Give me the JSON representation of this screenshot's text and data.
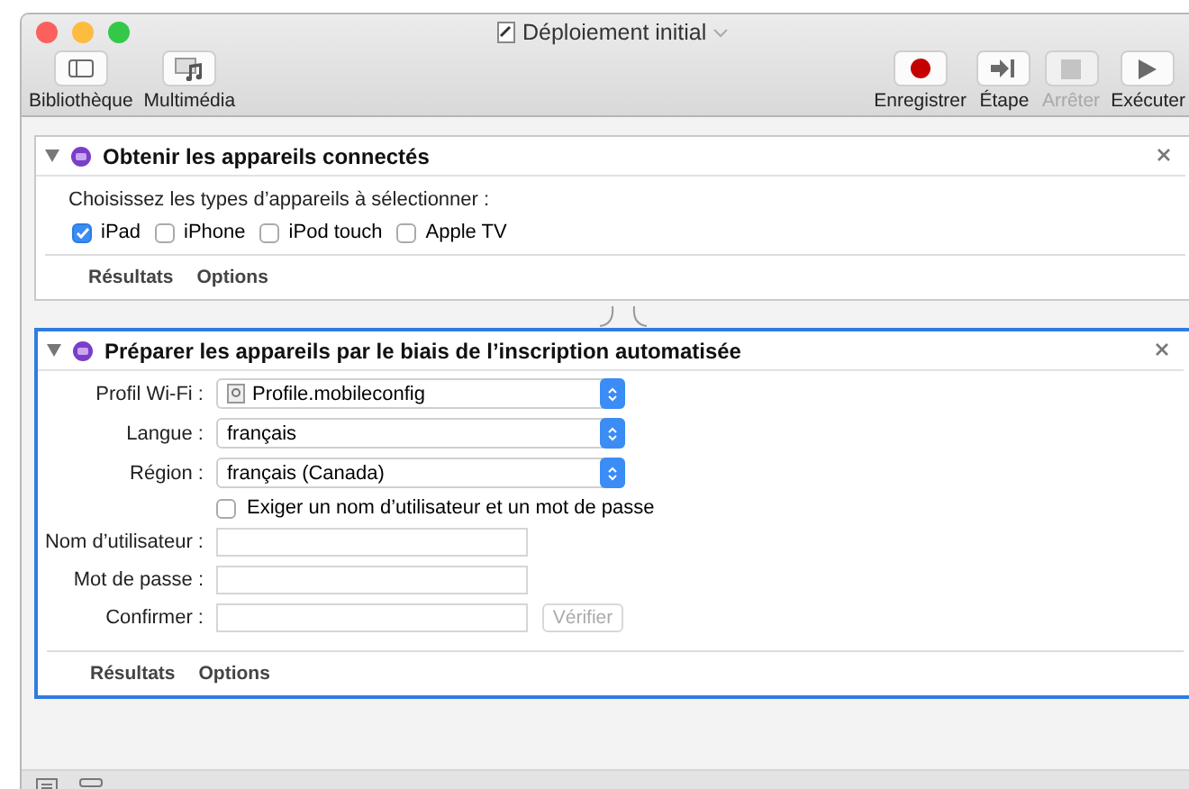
{
  "window": {
    "title": "Déploiement initial"
  },
  "toolbar": {
    "left": [
      {
        "label": "Bibliothèque",
        "kind": "library"
      },
      {
        "label": "Multimédia",
        "kind": "media"
      }
    ],
    "right": [
      {
        "label": "Enregistrer",
        "kind": "record",
        "disabled": false
      },
      {
        "label": "Étape",
        "kind": "step",
        "disabled": false
      },
      {
        "label": "Arrêter",
        "kind": "stop",
        "disabled": true
      },
      {
        "label": "Exécuter",
        "kind": "run",
        "disabled": false
      }
    ]
  },
  "actions": [
    {
      "title": "Obtenir les appareils connectés",
      "selected": false,
      "expanded": true,
      "kind": "devices",
      "prompt": "Choisissez les types d’appareils à sélectionner :",
      "options": [
        {
          "label": "iPad",
          "checked": true
        },
        {
          "label": "iPhone",
          "checked": false
        },
        {
          "label": "iPod touch",
          "checked": false
        },
        {
          "label": "Apple TV",
          "checked": false
        }
      ],
      "footer": [
        "Résultats",
        "Options"
      ]
    },
    {
      "title": "Préparer les appareils par le biais de l’inscription automatisée",
      "selected": true,
      "expanded": true,
      "kind": "form",
      "rows": [
        {
          "kind": "popup",
          "label": "Profil Wi-Fi :",
          "value": "Profile.mobileconfig",
          "file_icon": true
        },
        {
          "kind": "popup",
          "label": "Langue :",
          "value": "français"
        },
        {
          "kind": "popup",
          "label": "Région :",
          "value": "français (Canada)"
        },
        {
          "kind": "checkbox",
          "text": "Exiger un nom d’utilisateur et un mot de passe",
          "checked": false
        },
        {
          "kind": "text",
          "label": "Nom d’utilisateur :"
        },
        {
          "kind": "text",
          "label": "Mot de passe :"
        },
        {
          "kind": "text",
          "label": "Confirmer :",
          "button": {
            "label": "Vérifier",
            "disabled": true
          }
        }
      ],
      "footer": [
        "Résultats",
        "Options"
      ]
    }
  ]
}
